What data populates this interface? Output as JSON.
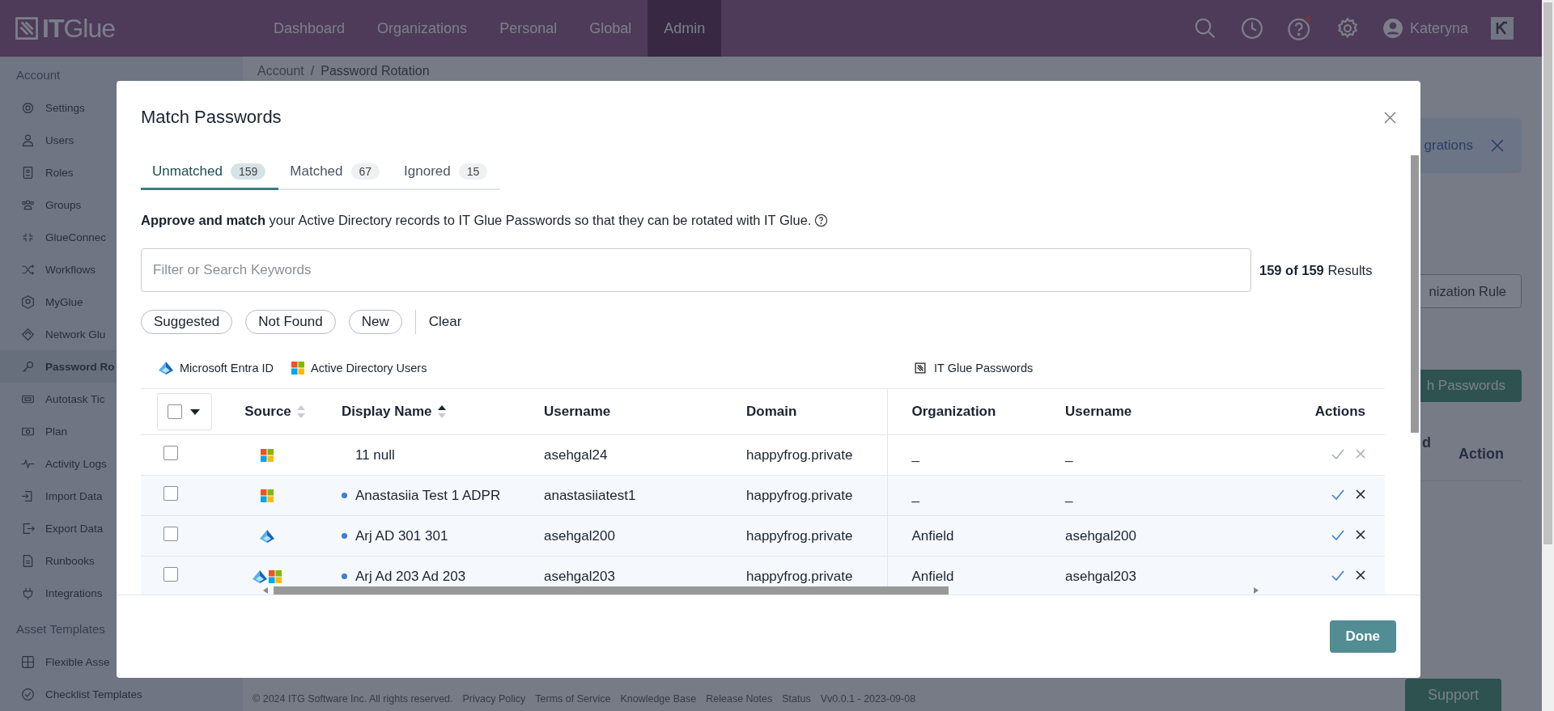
{
  "top_nav": {
    "logo": "**IT**Glue",
    "items": [
      {
        "label": "Dashboard",
        "selected": false
      },
      {
        "label": "Organizations",
        "selected": false
      },
      {
        "label": "Personal",
        "selected": false
      },
      {
        "label": "Global",
        "selected": false
      },
      {
        "label": "Admin",
        "selected": true
      }
    ],
    "user": "Kateryna"
  },
  "sidebar": {
    "sections": [
      {
        "title": "Account",
        "items": [
          {
            "label": "Settings",
            "selected": false
          },
          {
            "label": "Users",
            "selected": false
          },
          {
            "label": "Roles",
            "selected": false
          },
          {
            "label": "Groups",
            "selected": false
          },
          {
            "label": "GlueConnec",
            "selected": false
          },
          {
            "label": "Workflows",
            "selected": false
          },
          {
            "label": "MyGlue",
            "selected": false
          },
          {
            "label": "Network Glu",
            "selected": false
          },
          {
            "label": "Password Ro",
            "selected": true
          },
          {
            "label": "Autotask Tic",
            "selected": false
          },
          {
            "label": "Plan",
            "selected": false
          },
          {
            "label": "Activity Logs",
            "selected": false
          },
          {
            "label": "Import Data",
            "selected": false
          },
          {
            "label": "Export Data",
            "selected": false
          },
          {
            "label": "Runbooks",
            "selected": false
          },
          {
            "label": "Integrations",
            "selected": false
          }
        ]
      },
      {
        "title": "Asset Templates",
        "items": [
          {
            "label": "Flexible Asse",
            "selected": false
          },
          {
            "label": "Checklist Templates",
            "selected": false
          }
        ]
      }
    ]
  },
  "breadcrumb": {
    "items": [
      "Account",
      "Password Rotation"
    ],
    "separator": "/"
  },
  "background": {
    "banner_text": "grations",
    "rule_button": "nization Rule",
    "passwords_button": "h Passwords",
    "column_1": "d",
    "column_2": "Action",
    "support_button": "Support"
  },
  "footer": {
    "copyright": "© 2024 ITG Software Inc. All rights reserved.",
    "links": [
      "Privacy Policy",
      "Terms of Service",
      "Knowledge Base",
      "Release Notes",
      "Status"
    ],
    "version": "Vv0.0.1 - 2023-09-08"
  },
  "modal": {
    "title": "Match Passwords",
    "tabs": [
      {
        "label": "Unmatched",
        "count": "159",
        "selected": true
      },
      {
        "label": "Matched",
        "count": "67",
        "selected": false
      },
      {
        "label": "Ignored",
        "count": "15",
        "selected": false
      }
    ],
    "description": "**Approve and match** your Active Directory records to IT Glue Passwords so that they can be rotated with IT Glue.",
    "search": {
      "placeholder": "Filter or Search Keywords"
    },
    "results": "**159 of 159** Results",
    "filters": [
      "Suggested",
      "Not Found",
      "New"
    ],
    "clear": "Clear",
    "legend_left": [
      {
        "kind": "entra",
        "label": "Microsoft Entra ID"
      },
      {
        "kind": "windows",
        "label": "Active Directory Users"
      }
    ],
    "legend_right": "IT Glue Passwords",
    "columns": [
      {
        "label": "Source",
        "sorted": false
      },
      {
        "label": "Display Name",
        "sorted": true
      },
      {
        "label": "Username"
      },
      {
        "label": "Domain"
      },
      {
        "label": "Organization"
      },
      {
        "label": "Username"
      },
      {
        "label": "Actions"
      }
    ],
    "select_all_checked": false,
    "rows": [
      {
        "checked": false,
        "sources": [
          {
            "kind": "windows"
          }
        ],
        "flagged": false,
        "display_name": "11 null",
        "username": "asehgal24",
        "domain": "happyfrog.private",
        "organization": "_",
        "glue_username": "_",
        "actions_disabled": true
      },
      {
        "checked": false,
        "sources": [
          {
            "kind": "windows"
          }
        ],
        "flagged": true,
        "display_name": "Anastasiia Test 1 ADPR",
        "username": "anastasiiatest1",
        "domain": "happyfrog.private",
        "organization": "_",
        "glue_username": "_",
        "actions_disabled": false
      },
      {
        "checked": false,
        "sources": [
          {
            "kind": "entra"
          }
        ],
        "flagged": true,
        "display_name": "Arj AD 301 301",
        "username": "asehgal200",
        "domain": "happyfrog.private",
        "organization": "Anfield",
        "glue_username": "asehgal200",
        "actions_disabled": false
      },
      {
        "checked": false,
        "sources": [
          {
            "kind": "entra"
          },
          {
            "kind": "windows"
          }
        ],
        "flagged": true,
        "display_name": "Arj Ad 203 Ad 203",
        "username": "asehgal203",
        "domain": "happyfrog.private",
        "organization": "Anfield",
        "glue_username": "asehgal203",
        "actions_disabled": false
      }
    ],
    "done": "Done"
  }
}
